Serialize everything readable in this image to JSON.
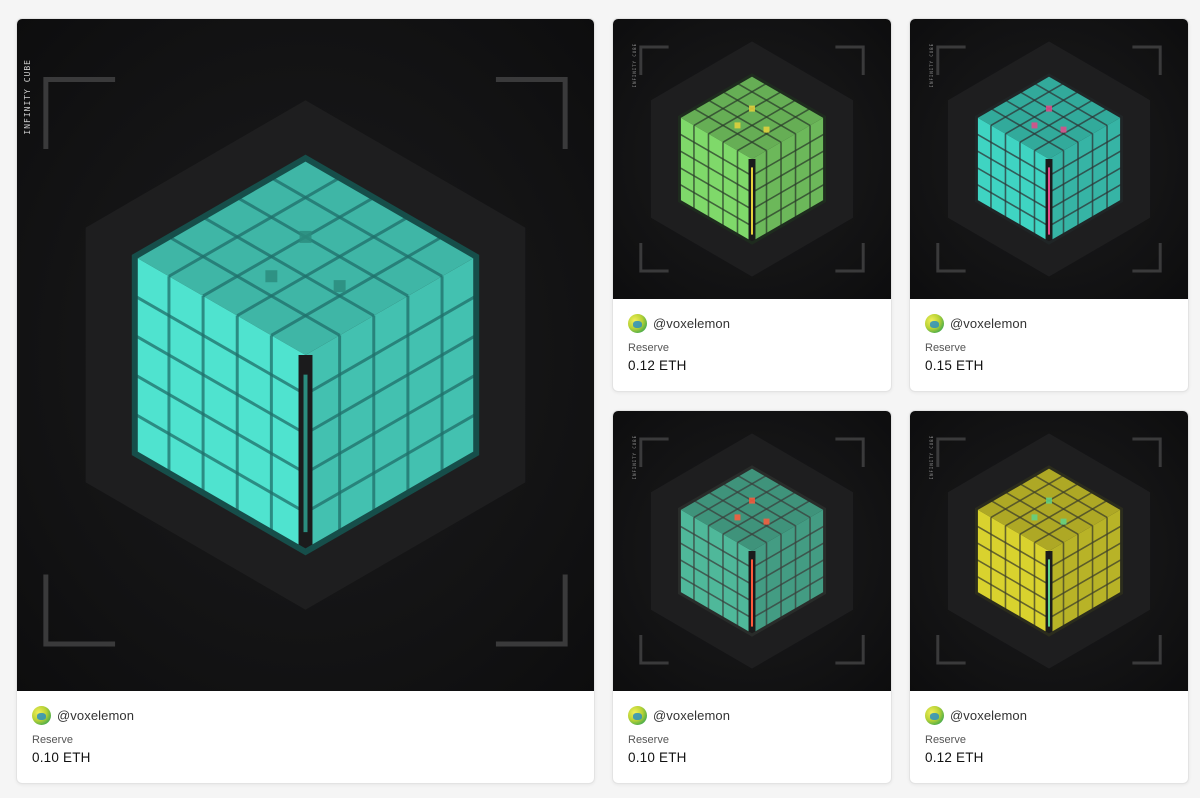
{
  "gallery": {
    "cards": [
      {
        "creator": "@voxelemon",
        "reserve_label": "Reserve",
        "reserve_value": "0.10 ETH",
        "art_caption": "INFINITY CUBE",
        "palette": {
          "main": "#4fe3cf",
          "dark": "#1f6f6a",
          "accent": "#2b8c7e"
        }
      },
      {
        "creator": "@voxelemon",
        "reserve_label": "Reserve",
        "reserve_value": "0.12 ETH",
        "art_caption": "INFINITY CUBE",
        "palette": {
          "main": "#7fd96a",
          "dark": "#2b3d2b",
          "accent": "#e6d23c"
        }
      },
      {
        "creator": "@voxelemon",
        "reserve_label": "Reserve",
        "reserve_value": "0.15 ETH",
        "art_caption": "INFINITY CUBE",
        "palette": {
          "main": "#3fd4c2",
          "dark": "#2e3536",
          "accent": "#e44a8a"
        }
      },
      {
        "creator": "@voxelemon",
        "reserve_label": "Reserve",
        "reserve_value": "0.10 ETH",
        "art_caption": "INFINITY CUBE",
        "palette": {
          "main": "#4fb89a",
          "dark": "#3a3f3c",
          "accent": "#ff5a3c"
        }
      },
      {
        "creator": "@voxelemon",
        "reserve_label": "Reserve",
        "reserve_value": "0.12 ETH",
        "art_caption": "INFINITY CUBE",
        "palette": {
          "main": "#d9d22e",
          "dark": "#3d3f2a",
          "accent": "#5fd28a"
        }
      }
    ]
  }
}
